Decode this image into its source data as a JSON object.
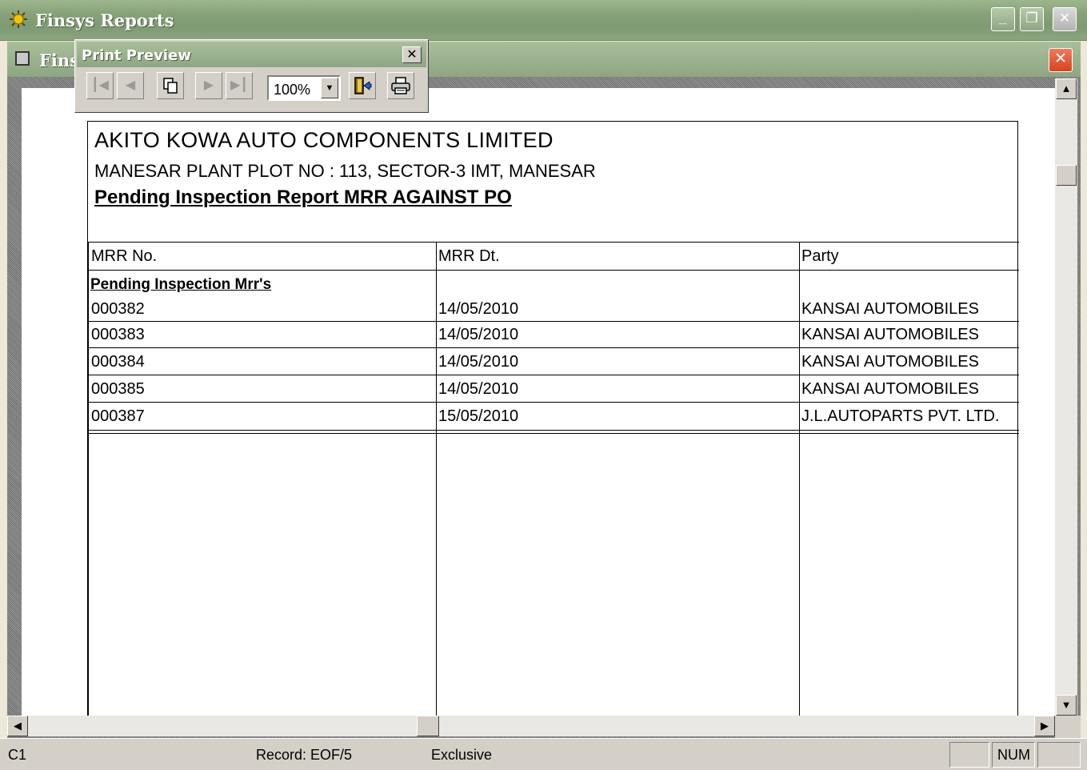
{
  "window": {
    "title": "Finsys Reports"
  },
  "child_window": {
    "title": "Fins"
  },
  "print_preview": {
    "title": "Print Preview",
    "zoom": "100%",
    "buttons": [
      "first-page",
      "previous-page",
      "select-page",
      "next-page",
      "last-page",
      "close-preview",
      "print"
    ]
  },
  "report": {
    "company": "AKITO KOWA AUTO COMPONENTS LIMITED",
    "address": "MANESAR PLANT PLOT NO : 113, SECTOR-3 IMT, MANESAR",
    "title": "Pending Inspection Report MRR AGAINST PO",
    "columns": [
      "MRR No.",
      "MRR Dt.",
      "Party"
    ],
    "section_label": "Pending Inspection Mrr's",
    "rows": [
      [
        "000382",
        "14/05/2010",
        "KANSAI AUTOMOBILES"
      ],
      [
        "000383",
        "14/05/2010",
        "KANSAI AUTOMOBILES"
      ],
      [
        "000384",
        "14/05/2010",
        "KANSAI AUTOMOBILES"
      ],
      [
        "000385",
        "14/05/2010",
        "KANSAI AUTOMOBILES"
      ],
      [
        "000387",
        "15/05/2010",
        "J.L.AUTOPARTS  PVT. LTD."
      ]
    ]
  },
  "status_bar": {
    "field": "C1",
    "record": "Record: EOF/5",
    "mode": "Exclusive",
    "num": "NUM"
  },
  "colors": {
    "title_bar": "#8ea583",
    "close_button": "#d64321",
    "chrome": "#d4d0c8"
  }
}
